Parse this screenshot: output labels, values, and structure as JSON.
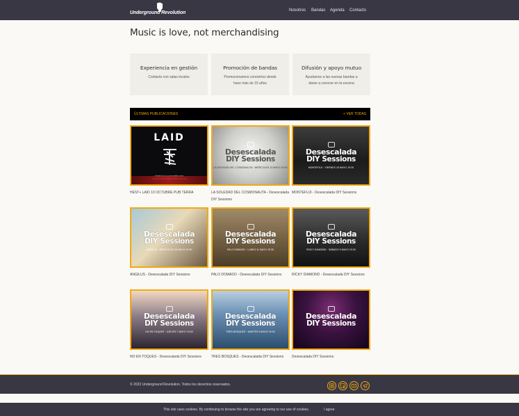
{
  "header": {
    "logo_text": "Underground Revolution",
    "nav": [
      "Nosotros",
      "Bandas",
      "Agenda",
      "Contacto"
    ]
  },
  "main": {
    "title": "Music is love, not merchandising",
    "features": [
      {
        "title": "Experiencia en gestión",
        "desc": "Contacto con salas locales"
      },
      {
        "title": "Promoción de bandas",
        "desc": "Promocionamos conciertos desde hace más de 15 años"
      },
      {
        "title": "Difusión y apoyo mutuo",
        "desc": "Ayudamos a las nuevas bandas a darse a conocer en la escena"
      }
    ]
  },
  "posts_section": {
    "heading": "ÚLTIMAS PUBLICACIONES",
    "view_all": "+ VER TODAS",
    "posts": [
      {
        "caption": "HEST+ LAID 10 OCTUBRE PUB TERRA",
        "poster": "laid",
        "image_text": [
          "LAID",
          "DOMINGO 10 OCTUBRE 2021",
          "19:00H PUB TERRA CASTELLÓN 8€"
        ]
      },
      {
        "caption": "LA SOLEDAD DEL COSMONAUTA - Desescalada DIY Sessions",
        "poster": "ds",
        "image_text": [
          "Desescalada",
          "DIY Sessions",
          "LA SOLEDAD DEL COSMONAUTA · MIÉRCOLES 13 MAYO 19:30"
        ]
      },
      {
        "caption": "MONTEFUJI - Desescalada DIY Sessions",
        "poster": "ds",
        "image_text": [
          "Desescalada",
          "DIY Sessions",
          "MONTEFUJI · VIERNES 15 MAYO 19:30"
        ]
      },
      {
        "caption": "ANGILUS - Desescalada DIY Sessions",
        "poster": "ds",
        "image_text": [
          "Desescalada",
          "DIY Sessions",
          "ANGILUS · MIÉRCOLES 06 MAYO 19:30"
        ]
      },
      {
        "caption": "PALO DOMADO - Desescalada DIY Sessions",
        "poster": "ds",
        "image_text": [
          "Desescalada",
          "DIY Sessions",
          "PALO DOMADO · LUNES 11 MAYO 19:30"
        ]
      },
      {
        "caption": "RICKY DIAMOND - Desescalada DIY Sessions",
        "poster": "ds",
        "image_text": [
          "Desescalada",
          "DIY Sessions",
          "RICKY DIAMOND · SÁBADO 9 MAYO 19:30"
        ]
      },
      {
        "caption": "NO EN TOQUES - Desescalada DIY Sessions",
        "poster": "ds",
        "image_text": [
          "Desescalada",
          "DIY Sessions",
          "NO EN TOQUES · JUEVES 7 MAYO 19:30"
        ]
      },
      {
        "caption": "TRES BOSQUES - Desescalada DIY Sessions",
        "poster": "ds",
        "image_text": [
          "Desescalada",
          "DIY Sessions",
          "TRES BOSQUES · MARTES 5 MAYO 19:30"
        ]
      },
      {
        "caption": "Desescalada DIY Sessions",
        "poster": "ds",
        "image_text": [
          "Desescalada",
          "DIY Sessions",
          ""
        ]
      }
    ]
  },
  "footer": {
    "copyright": "© 2023 Underground Revolution. Todos los derechos reservados.",
    "social": [
      "instagram-icon",
      "facebook-icon",
      "youtube-icon",
      "telegram-icon"
    ]
  },
  "cookie_bar": {
    "text": "This site uses cookies. By continuing to browse the site you are agreeing to our use of cookies.",
    "agree": "I agree"
  },
  "colors": {
    "header_bg": "#3a3744",
    "accent": "#f3a90f",
    "page_bg": "#faf9f5",
    "card_bg": "#efeee9"
  }
}
